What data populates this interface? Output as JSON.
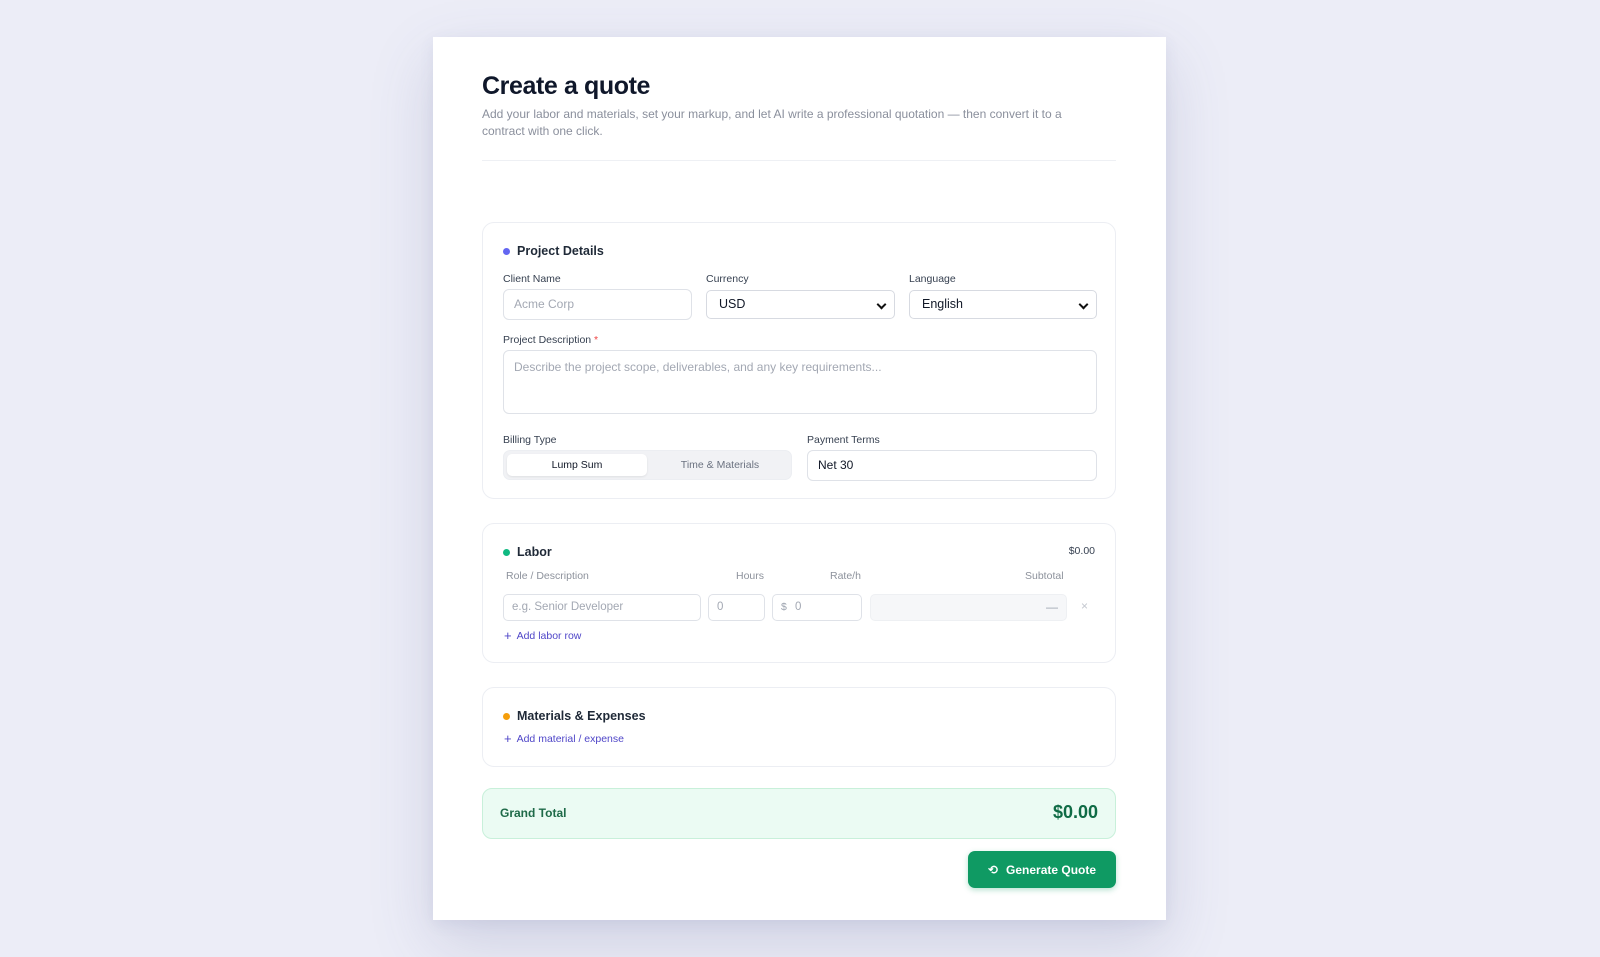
{
  "header": {
    "title": "Create a quote",
    "subtitle": "Add your labor and materials, set your markup, and let AI write a professional quotation — then convert it to a contract with one click."
  },
  "project": {
    "title": "Project Details",
    "client_label": "Client Name",
    "client_placeholder": "Acme Corp",
    "currency_label": "Currency",
    "currency_value": "USD",
    "language_label": "Language",
    "language_value": "English",
    "description_label": "Project Description",
    "description_required": "*",
    "description_placeholder": "Describe the project scope, deliverables, and any key requirements...",
    "billing_label": "Billing Type",
    "billing_options": [
      "Lump Sum",
      "Time & Materials"
    ],
    "payment_label": "Payment Terms",
    "payment_value": "Net 30"
  },
  "labor": {
    "title": "Labor",
    "total": "$0.00",
    "columns": [
      "Role / Description",
      "Hours",
      "Rate/h",
      "Subtotal"
    ],
    "row": {
      "role_placeholder": "e.g. Senior Developer",
      "hours_placeholder": "0",
      "rate_prefix": "$",
      "rate_placeholder": "0",
      "subtotal": "—",
      "remove": "×"
    },
    "add_label": "Add labor row"
  },
  "materials": {
    "title": "Materials & Expenses",
    "add_label": "Add material / expense"
  },
  "grand_total": {
    "label": "Grand Total",
    "value": "$0.00"
  },
  "actions": {
    "generate_label": "Generate Quote"
  },
  "colors": {
    "project_dot": "#6366f1",
    "labor_dot": "#10b981",
    "materials_dot": "#f59e0b",
    "accent_green": "#0f9a63"
  }
}
